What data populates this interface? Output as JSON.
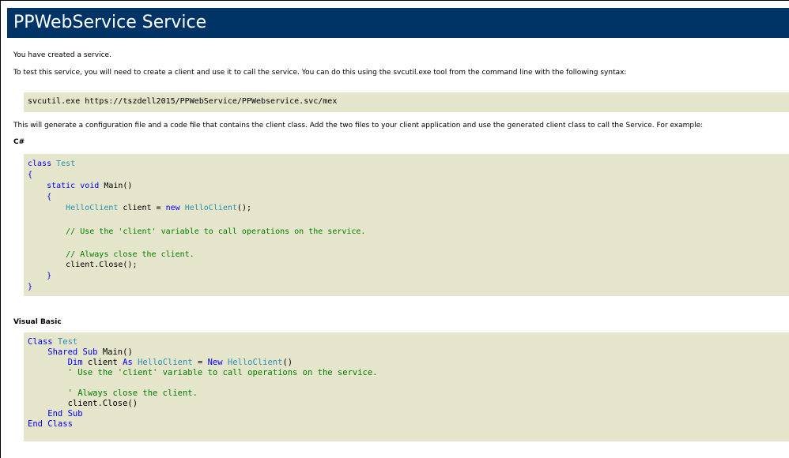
{
  "page": {
    "title": "PPWebService Service",
    "intro": "You have created a service.",
    "instructions": "To test this service, you will need to create a client and use it to call the service. You can do this using the svcutil.exe tool from the command line with the following syntax:",
    "svcutil_command": "svcutil.exe https://tszdell2015/PPWebService/PPWebservice.svc/mex",
    "generate_note": "This will generate a configuration file and a code file that contains the client class. Add the two files to your client application and use the generated client class to call the Service. For example:",
    "csharp_heading": "C#",
    "vb_heading": "Visual Basic"
  },
  "code": {
    "cs": {
      "l1_kw": "class",
      "l1_ty": " Test",
      "l2": "{",
      "l3_kw": "    static void",
      "l3_rest": " Main()",
      "l4": "    {",
      "l5_ty1": "        HelloClient",
      "l5_mid": " client = ",
      "l5_kw": "new",
      "l5_ty2": " HelloClient",
      "l5_end": "();",
      "l7": "        // Use the 'client' variable to call operations on the service.",
      "l9": "        // Always close the client.",
      "l10": "        client.Close();",
      "l11": "    }",
      "l12": "}"
    },
    "vb": {
      "l1_kw": "Class",
      "l1_ty": " Test",
      "l2_kw": "    Shared Sub",
      "l2_rest": " Main()",
      "l3_kw1": "        Dim",
      "l3_mid": " client ",
      "l3_kw2": "As",
      "l3_ty1": " HelloClient",
      "l3_eq": " = ",
      "l3_kw3": "New",
      "l3_ty2": " HelloClient",
      "l3_end": "()",
      "l4": "        ' Use the 'client' variable to call operations on the service.",
      "l6": "        ' Always close the client.",
      "l7": "        client.Close()",
      "l8": "    End Sub",
      "l9": "End Class"
    }
  },
  "colors": {
    "header_bg": "#003366",
    "code_bg": "#e5e5cc",
    "keyword": "#0000ff",
    "type": "#2b91af",
    "comment": "#008000"
  }
}
